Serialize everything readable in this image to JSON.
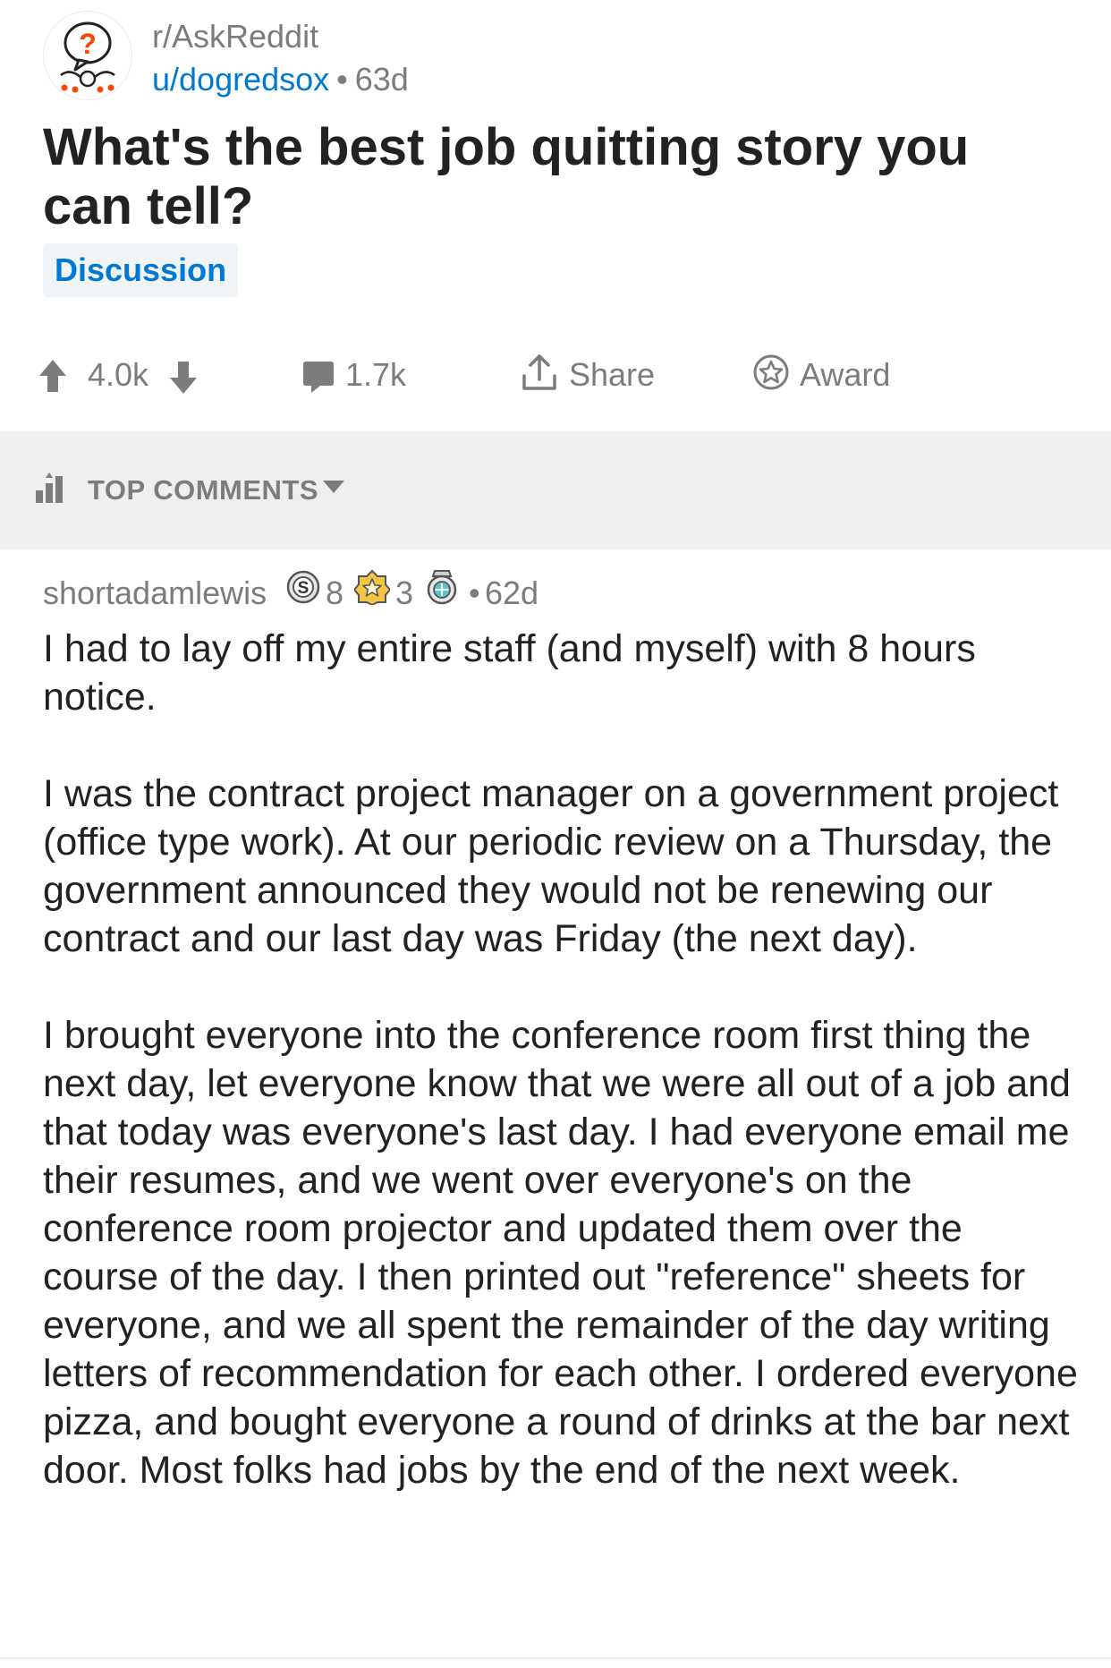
{
  "post": {
    "subreddit": "r/AskReddit",
    "author": "u/dogredsox",
    "meta_separator": "•",
    "age": "63d",
    "title": "What's the best job quitting story you can tell?",
    "flair": "Discussion"
  },
  "actions": {
    "score": "4.0k",
    "comments": "1.7k",
    "share_label": "Share",
    "award_label": "Award"
  },
  "sort": {
    "label": "TOP COMMENTS"
  },
  "comment": {
    "author": "shortadamlewis",
    "awards": [
      {
        "icon": "silver-award-icon",
        "count": "8"
      },
      {
        "icon": "gold-award-icon",
        "count": "3"
      },
      {
        "icon": "platinum-award-icon",
        "count": ""
      }
    ],
    "meta_separator": "•",
    "age": "62d",
    "paragraphs": [
      "I had to lay off my entire staff (and myself) with 8 hours notice.",
      "I was the contract project manager on a government project (office type work). At our periodic review on a Thursday, the government announced they would not be renewing our contract and our last day was Friday (the next day).",
      "I brought everyone into the conference room first thing the next day, let everyone know that we were all out of a job and that today was everyone's last day. I had everyone email me their resumes, and we went over everyone's on the conference room projector and updated them over the course of the day. I then printed out \"reference\" sheets for everyone, and we all spent the remainder of the day writing letters of recommendation for each other. I ordered everyone pizza, and bought everyone a round of drinks at the bar next door. Most folks had jobs by the end of the next week."
    ]
  },
  "colors": {
    "link_blue": "#0079d3",
    "meta_gray": "#7c7c7c",
    "text_dark": "#222222",
    "sort_bar_bg": "#edeff1",
    "flair_bg": "#f1f4f6",
    "askreddit_orange": "#ff4500",
    "gold": "#e8b730",
    "silver": "#b8b8b8",
    "platinum": "#5ac8c8"
  }
}
